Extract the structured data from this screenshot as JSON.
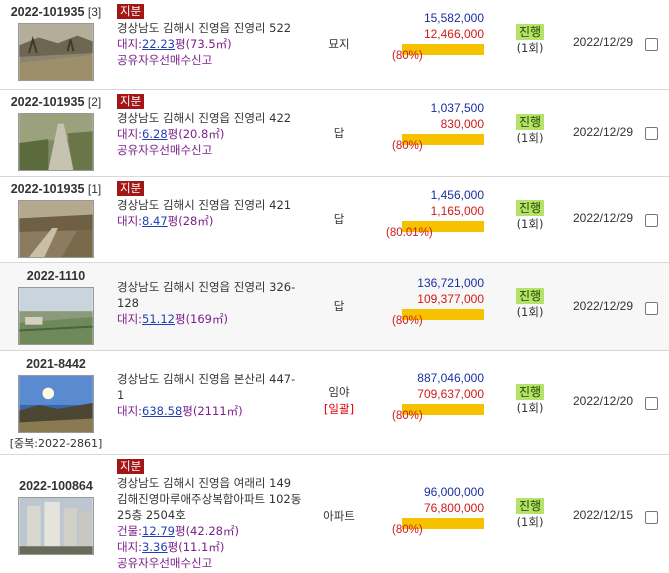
{
  "rows": [
    {
      "case_no": "2022-101935",
      "case_sub": "[3]",
      "badge": "지분",
      "address": "경상남도 김해시 진영읍 진영리 522",
      "area_label": "대지:",
      "area_py": "22.23",
      "area_unit": "평(73.5㎡)",
      "share_text": "공유자우선매수신고",
      "use": "묘지",
      "use_note": "",
      "appraisal": "15,582,000",
      "minimum": "12,466,000",
      "percent": "(80%)",
      "status": "진행",
      "rounds": "(1회)",
      "date": "2022/12/29"
    },
    {
      "case_no": "2022-101935",
      "case_sub": "[2]",
      "badge": "지분",
      "address": "경상남도 김해시 진영읍 진영리 422",
      "area_label": "대지:",
      "area_py": "6.28",
      "area_unit": "평(20.8㎡)",
      "share_text": "공유자우선매수신고",
      "use": "답",
      "use_note": "",
      "appraisal": "1,037,500",
      "minimum": "830,000",
      "percent": "(80%)",
      "status": "진행",
      "rounds": "(1회)",
      "date": "2022/12/29"
    },
    {
      "case_no": "2022-101935",
      "case_sub": "[1]",
      "badge": "지분",
      "address": "경상남도 김해시 진영읍 진영리 421",
      "area_label": "대지:",
      "area_py": "8.47",
      "area_unit": "평(28㎡)",
      "share_text": "",
      "use": "답",
      "use_note": "",
      "appraisal": "1,456,000",
      "minimum": "1,165,000",
      "percent": "(80.01%)",
      "status": "진행",
      "rounds": "(1회)",
      "date": "2022/12/29"
    },
    {
      "case_no": "2022-1110",
      "case_sub": "",
      "badge": "",
      "address": "경상남도 김해시 진영읍 진영리 326-128",
      "area_label": "대지:",
      "area_py": "51.12",
      "area_unit": "평(169㎡)",
      "share_text": "",
      "use": "답",
      "use_note": "",
      "appraisal": "136,721,000",
      "minimum": "109,377,000",
      "percent": "(80%)",
      "status": "진행",
      "rounds": "(1회)",
      "date": "2022/12/29"
    },
    {
      "case_no": "2021-8442",
      "case_sub": "",
      "badge": "",
      "dup": "[중복:2022-2861]",
      "address": "경상남도 김해시 진영읍 본산리 447-1",
      "area_label": "대지:",
      "area_py": "638.58",
      "area_unit": "평(2111㎡)",
      "share_text": "",
      "use": "임야",
      "use_note": "[일괄]",
      "appraisal": "887,046,000",
      "minimum": "709,637,000",
      "percent": "(80%)",
      "status": "진행",
      "rounds": "(1회)",
      "date": "2022/12/20"
    },
    {
      "case_no": "2022-100864",
      "case_sub": "",
      "badge": "지분",
      "address": "경상남도 김해시 진영읍 여래리 149 김해진영마루애주상복합아파트 102동 25층 2504호",
      "bldg_label": "건물:",
      "bldg_py": "12.79",
      "bldg_unit": "평(42.28㎡)",
      "area_label": "대지:",
      "area_py": "3.36",
      "area_unit": "평(11.1㎡)",
      "share_text": "공유자우선매수신고",
      "use": "아파트",
      "use_note": "",
      "appraisal": "96,000,000",
      "minimum": "76,800,000",
      "percent": "(80%)",
      "status": "진행",
      "rounds": "(1회)",
      "date": "2022/12/15"
    }
  ]
}
